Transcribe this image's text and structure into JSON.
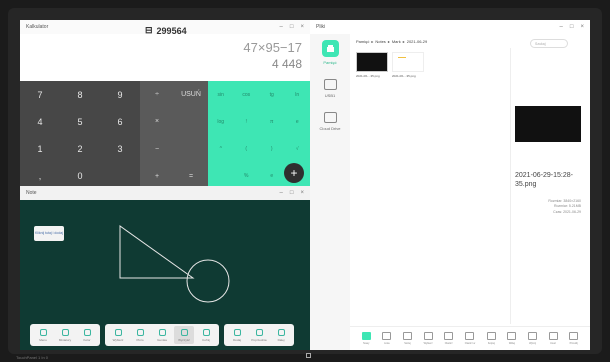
{
  "calculator": {
    "title": "Kalkulator",
    "memory_value": "299564",
    "expression": "47×95−17",
    "result": "4 448",
    "num_keys": [
      "7",
      "8",
      "9",
      "4",
      "5",
      "6",
      "1",
      "2",
      "3",
      ",",
      "0",
      ""
    ],
    "op_keys": [
      "÷",
      "USUŃ",
      "×",
      "",
      "−",
      "",
      "+",
      "="
    ],
    "sci_keys": [
      "sin",
      "cos",
      "tg",
      "ln",
      "log",
      "!",
      "π",
      "e",
      "^",
      "(",
      ")",
      "√",
      "",
      "%",
      "e",
      ""
    ],
    "fab_label": "+"
  },
  "note": {
    "title": "Note",
    "sticky_text": "Kliknij tutaj i dodaj",
    "toolbar": [
      [
        {
          "label": "Menu"
        },
        {
          "label": "Miniatury"
        },
        {
          "label": "Kolor"
        }
      ],
      [
        {
          "label": "Wybierz"
        },
        {
          "label": "Pióro"
        },
        {
          "label": "Gumka"
        },
        {
          "label": "Wyczyść",
          "active": true
        },
        {
          "label": "Cofnij"
        }
      ],
      [
        {
          "label": "Dodaj"
        },
        {
          "label": "Poprzednia"
        },
        {
          "label": "Dalej"
        }
      ]
    ]
  },
  "files": {
    "title": "Pliki",
    "search_placeholder": "Szukaj",
    "breadcrumb": [
      "Pamięć",
      "Notes",
      "Mark",
      "2021-06-29"
    ],
    "sidebar": [
      {
        "label": "Pamięć",
        "active": true,
        "icon": "storage-icon"
      },
      {
        "label": "USB1",
        "active": false,
        "icon": "usb-icon"
      },
      {
        "label": "Cloud Drive",
        "active": false,
        "icon": "cloud-icon"
      }
    ],
    "items": [
      {
        "name": "2021-06-...35.png",
        "kind": "image"
      },
      {
        "name": "2021-06-...35.png",
        "kind": "doc"
      }
    ],
    "preview": {
      "name": "2021-06-29-15:28-35.png",
      "size": "Rozmiar: 3840×2160",
      "format": "Rozmiar: 5.21MB",
      "date": "Czas: 2021-06-29"
    },
    "bottom_bar": [
      "Nowy",
      "Lista",
      "Sortuj",
      "Wybierz",
      "Otwórz",
      "Otwórz w",
      "Kopiuj",
      "Wklej",
      "Wytnij",
      "Usuń",
      "Prześlij"
    ]
  },
  "taskbar": {
    "left_text": "TouchPanel 1 In 0"
  },
  "colors": {
    "accent": "#3ee6b4",
    "note_bg": "#0f3a33",
    "keypad_dark": "#474747"
  }
}
